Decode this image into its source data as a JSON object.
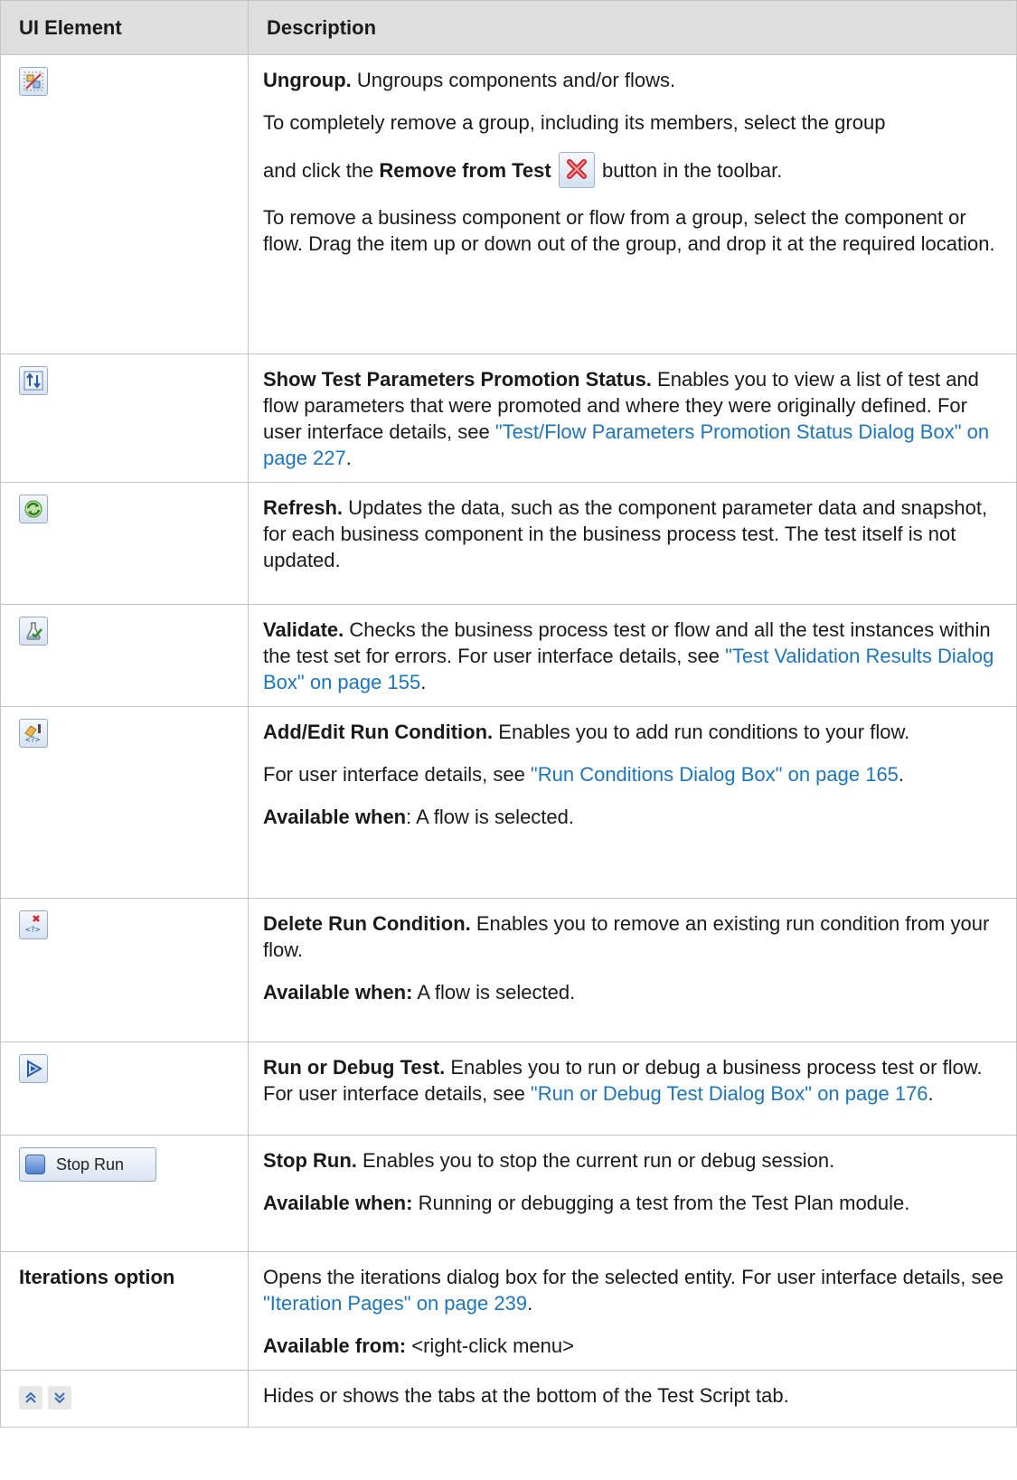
{
  "header": {
    "col1": "UI Element",
    "col2": "Description"
  },
  "colors": {
    "link": "#1b76c1",
    "header_bg": "#dedede",
    "border": "#c4c4c4"
  },
  "rows": [
    {
      "icon": "ungroup-icon",
      "title": "Ungroup.",
      "text": " Ungroups components and/or flows.",
      "p2": "To completely remove a group, including its members, select the group",
      "p3_pre": "and click the ",
      "p3_bold": "Remove from Test",
      "p3_post": " button in the toolbar.",
      "p4": "To remove a business component or flow from a group, select the component or flow. Drag the item up or down out of the group, and drop it at the required location."
    },
    {
      "icon": "promotion-status-icon",
      "title": "Show Test Parameters Promotion Status.",
      "text": " Enables you to view a list of test and flow parameters that were promoted and where they were originally defined. For user interface details, see ",
      "link": "\"Test/Flow Parameters Promotion Status Dialog Box\" on page 227",
      "after": "."
    },
    {
      "icon": "refresh-icon",
      "title": "Refresh.",
      "text": " Updates the data, such as the component parameter data and snapshot, for each business component in the business process test. The test itself is not updated."
    },
    {
      "icon": "validate-icon",
      "title": "Validate.",
      "text": " Checks the business process test or flow and all the test instances within the test set for errors. For user interface details, see ",
      "link": "\"Test Validation Results Dialog Box\" on page 155",
      "after": "."
    },
    {
      "icon": "add-run-condition-icon",
      "title": "Add/Edit Run Condition.",
      "text": " Enables you to add run conditions to your flow.",
      "p2_pre": "For user interface details, see ",
      "p2_link": "\"Run Conditions Dialog Box\" on page 165",
      "p2_after": ".",
      "avail_label": "Available when",
      "avail_text": ": A flow is selected."
    },
    {
      "icon": "delete-run-condition-icon",
      "title": "Delete Run Condition.",
      "text": " Enables you to remove an existing run condition from your flow.",
      "avail_label": "Available when:",
      "avail_text": " A flow is selected."
    },
    {
      "icon": "run-debug-icon",
      "title": "Run or Debug Test.",
      "text": " Enables you to run or debug a business process test or flow. For user interface details, see ",
      "link": "\"Run or Debug Test Dialog Box\" on page 176",
      "after": "."
    },
    {
      "button_label": "Stop Run",
      "title": "Stop Run.",
      "text": " Enables you to stop the current run or debug session.",
      "avail_label": "Available when:",
      "avail_text": " Running or debugging a test from the Test Plan module."
    },
    {
      "label": "Iterations option",
      "text": "Opens the iterations dialog box for the selected entity. For user interface details, see ",
      "link": "\"Iteration Pages\" on page 239",
      "after": ".",
      "avail_label": "Available from:",
      "avail_text": " <right-click menu>"
    },
    {
      "icon": "collapse-expand-icons",
      "text": "Hides or shows the tabs at the bottom of the Test Script tab."
    }
  ]
}
